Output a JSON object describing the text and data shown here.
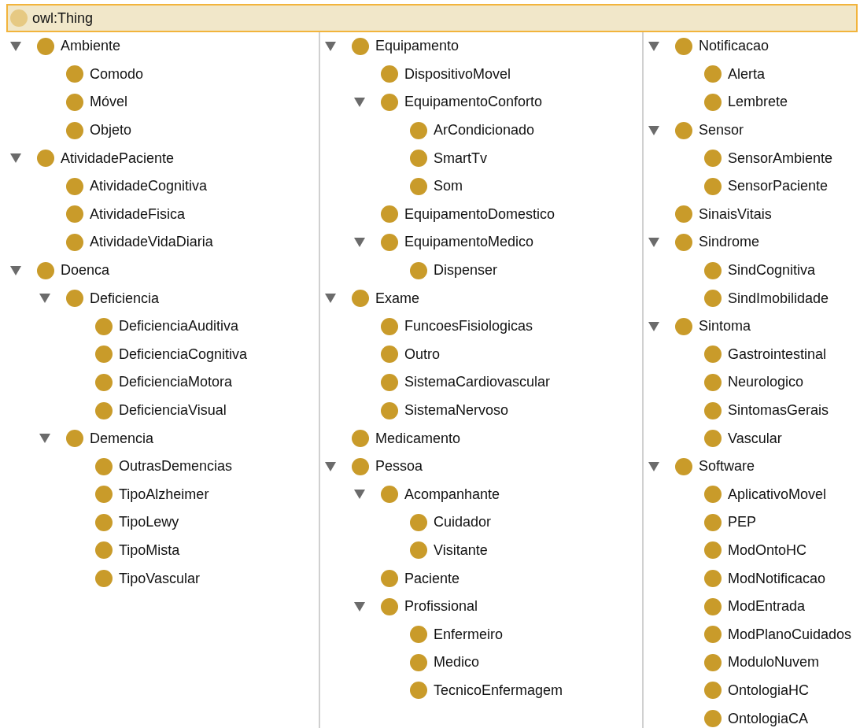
{
  "root": {
    "label": "owl:Thing",
    "selected": true
  },
  "columns": [
    [
      {
        "label": "Ambiente",
        "expanded": true,
        "children": [
          {
            "label": "Comodo"
          },
          {
            "label": "Móvel"
          },
          {
            "label": "Objeto"
          }
        ]
      },
      {
        "label": "AtividadePaciente",
        "expanded": true,
        "children": [
          {
            "label": "AtividadeCognitiva"
          },
          {
            "label": "AtividadeFisica"
          },
          {
            "label": "AtividadeVidaDiaria"
          }
        ]
      },
      {
        "label": "Doenca",
        "expanded": true,
        "children": [
          {
            "label": "Deficiencia",
            "expanded": true,
            "children": [
              {
                "label": "DeficienciaAuditiva"
              },
              {
                "label": "DeficienciaCognitiva"
              },
              {
                "label": "DeficienciaMotora"
              },
              {
                "label": "DeficienciaVisual"
              }
            ]
          },
          {
            "label": "Demencia",
            "expanded": true,
            "children": [
              {
                "label": "OutrasDemencias"
              },
              {
                "label": "TipoAlzheimer"
              },
              {
                "label": "TipoLewy"
              },
              {
                "label": "TipoMista"
              },
              {
                "label": "TipoVascular"
              }
            ]
          }
        ]
      }
    ],
    [
      {
        "label": "Equipamento",
        "expanded": true,
        "children": [
          {
            "label": "DispositivoMovel"
          },
          {
            "label": "EquipamentoConforto",
            "expanded": true,
            "children": [
              {
                "label": "ArCondicionado"
              },
              {
                "label": "SmartTv"
              },
              {
                "label": "Som"
              }
            ]
          },
          {
            "label": "EquipamentoDomestico"
          },
          {
            "label": "EquipamentoMedico",
            "expanded": true,
            "children": [
              {
                "label": "Dispenser"
              }
            ]
          }
        ]
      },
      {
        "label": "Exame",
        "expanded": true,
        "children": [
          {
            "label": "FuncoesFisiologicas"
          },
          {
            "label": "Outro"
          },
          {
            "label": "SistemaCardiovascular"
          },
          {
            "label": "SistemaNervoso"
          }
        ]
      },
      {
        "label": "Medicamento"
      },
      {
        "label": "Pessoa",
        "expanded": true,
        "children": [
          {
            "label": "Acompanhante",
            "expanded": true,
            "children": [
              {
                "label": "Cuidador"
              },
              {
                "label": "Visitante"
              }
            ]
          },
          {
            "label": "Paciente"
          },
          {
            "label": "Profissional",
            "expanded": true,
            "children": [
              {
                "label": "Enfermeiro"
              },
              {
                "label": "Medico"
              },
              {
                "label": "TecnicoEnfermagem"
              }
            ]
          }
        ]
      }
    ],
    [
      {
        "label": "Notificacao",
        "expanded": true,
        "children": [
          {
            "label": "Alerta"
          },
          {
            "label": "Lembrete"
          }
        ]
      },
      {
        "label": "Sensor",
        "expanded": true,
        "children": [
          {
            "label": "SensorAmbiente"
          },
          {
            "label": "SensorPaciente"
          }
        ]
      },
      {
        "label": "SinaisVitais"
      },
      {
        "label": "Sindrome",
        "expanded": true,
        "children": [
          {
            "label": "SindCognitiva"
          },
          {
            "label": "SindImobilidade"
          }
        ]
      },
      {
        "label": "Sintoma",
        "expanded": true,
        "children": [
          {
            "label": "Gastrointestinal"
          },
          {
            "label": "Neurologico"
          },
          {
            "label": "SintomasGerais"
          },
          {
            "label": "Vascular"
          }
        ]
      },
      {
        "label": "Software",
        "expanded": true,
        "children": [
          {
            "label": "AplicativoMovel"
          },
          {
            "label": "PEP"
          },
          {
            "label": "ModOntoHC"
          },
          {
            "label": "ModNotificacao"
          },
          {
            "label": "ModEntrada"
          },
          {
            "label": "ModPlanoCuidados"
          },
          {
            "label": "ModuloNuvem"
          },
          {
            "label": "OntologiaHC"
          },
          {
            "label": "OntologiaCA"
          }
        ]
      }
    ]
  ]
}
